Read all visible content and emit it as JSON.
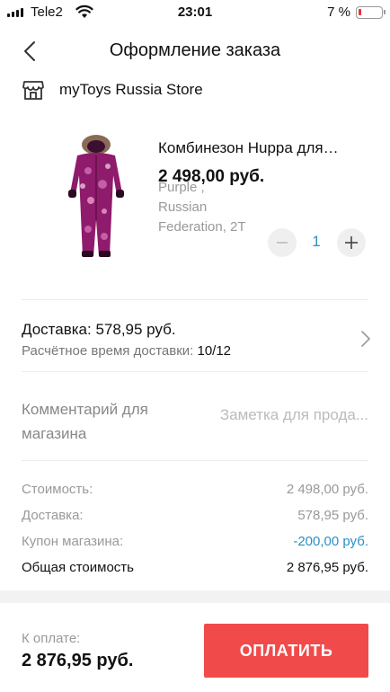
{
  "status_bar": {
    "carrier": "Tele2",
    "time": "23:01",
    "battery": "7 %",
    "battery_level": 0.07
  },
  "header": {
    "title": "Оформление заказа",
    "back_icon": "chevron-left-icon"
  },
  "store": {
    "icon": "store-icon",
    "name": "myToys Russia Store"
  },
  "product": {
    "title": "Комбинезон Huppa для…",
    "variant": "Purple , Russian Federation, 2T",
    "price": "2 498,00 руб.",
    "quantity": "1",
    "minus_icon": "minus-icon",
    "plus_icon": "plus-icon"
  },
  "delivery": {
    "price_text": "Доставка: 578,95 руб.",
    "time_label": "Расчётное время доставки: ",
    "time_value": "10/12"
  },
  "comment": {
    "label": "Комментарий для магазина",
    "placeholder": "Заметка для прода..."
  },
  "summary": {
    "rows": [
      {
        "label": "Стоимость:",
        "value": "2 498,00 руб."
      },
      {
        "label": "Доставка:",
        "value": "578,95 руб."
      },
      {
        "label": "Купон магазина:",
        "value": "-200,00 руб."
      },
      {
        "label": "Общая стоимость",
        "value": "2 876,95 руб."
      }
    ]
  },
  "footer": {
    "pay_label": "К оплате:",
    "pay_total": "2 876,95 руб.",
    "pay_button": "ОПЛАТИТЬ"
  },
  "colors": {
    "accent_red": "#f04a4a",
    "link_blue": "#2b8fc6",
    "muted": "#999999"
  }
}
